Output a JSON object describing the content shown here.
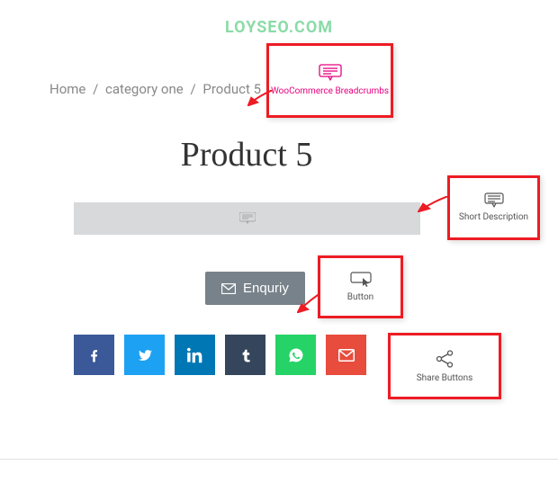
{
  "watermark": "LOYSEO.COM",
  "breadcrumb": {
    "home": "Home",
    "category": "category one",
    "product": "Product 5"
  },
  "title": "Product 5",
  "enquiry_label": "Enquriy",
  "callouts": {
    "breadcrumbs": "WooCommerce Breadcrumbs",
    "short_description": "Short Description",
    "button": "Button",
    "share_buttons": "Share Buttons"
  },
  "share": {
    "facebook": "facebook",
    "twitter": "twitter",
    "linkedin": "linkedin",
    "tumblr": "tumblr",
    "whatsapp": "whatsapp",
    "email": "email"
  }
}
